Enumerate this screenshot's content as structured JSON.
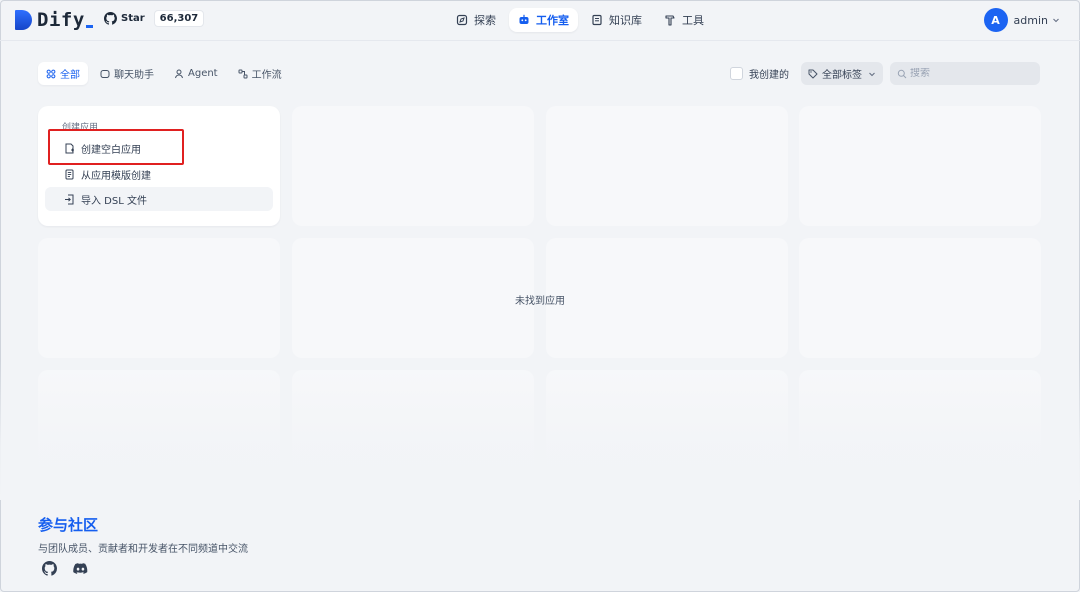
{
  "header": {
    "logo_text": "Dify",
    "github": {
      "star_label": "Star",
      "count": "66,307"
    },
    "nav": [
      {
        "label": "探索",
        "icon": "explore-icon"
      },
      {
        "label": "工作室",
        "icon": "robot-icon",
        "active": true
      },
      {
        "label": "知识库",
        "icon": "book-icon"
      },
      {
        "label": "工具",
        "icon": "hammer-icon"
      }
    ],
    "user": {
      "avatar_letter": "A",
      "name": "admin"
    }
  },
  "filters": {
    "tabs": [
      {
        "label": "全部",
        "active": true,
        "icon": "grid-icon"
      },
      {
        "label": "聊天助手",
        "icon": "chat-icon"
      },
      {
        "label": "Agent",
        "icon": "agent-icon"
      },
      {
        "label": "工作流",
        "icon": "workflow-icon"
      }
    ],
    "my_created_label": "我创建的",
    "tag_filter_label": "全部标签",
    "search_placeholder": "搜索"
  },
  "create_card": {
    "title": "创建应用",
    "items": [
      {
        "label": "创建空白应用",
        "icon": "file-plus-icon"
      },
      {
        "label": "从应用模版创建",
        "icon": "template-icon"
      },
      {
        "label": "导入 DSL 文件",
        "icon": "import-icon"
      }
    ]
  },
  "empty_text": "未找到应用",
  "community": {
    "title": "参与社区",
    "subtitle": "与团队成员、贡献者和开发者在不同频道中交流"
  },
  "colors": {
    "accent": "#155eef",
    "highlight": "#e02020",
    "background": "#f2f4f7"
  }
}
